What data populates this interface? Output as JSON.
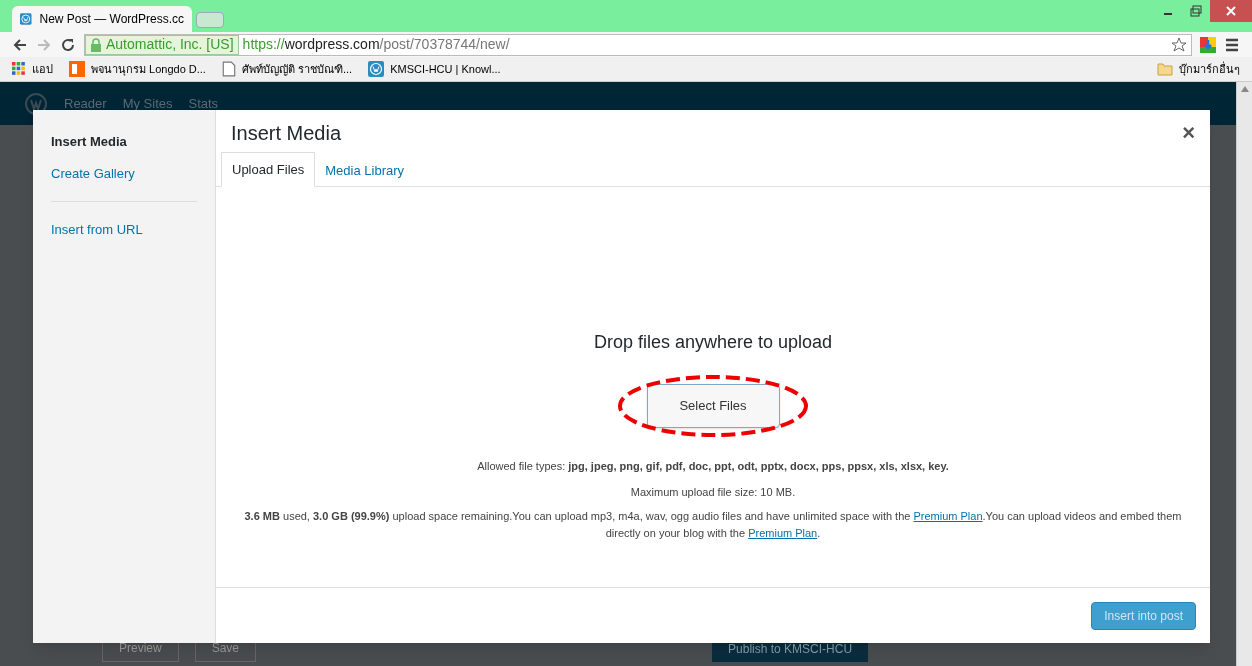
{
  "browser": {
    "tab_title": "New Post — WordPress.cc",
    "security_label": "Automattic, Inc. [US]",
    "url_scheme": "https://",
    "url_host": "wordpress.com",
    "url_path": "/post/70378744/new/",
    "bookmarks": [
      {
        "kind": "apps",
        "label": "แอป"
      },
      {
        "kind": "site",
        "label": "พจนานุกรม Longdo D..."
      },
      {
        "kind": "page",
        "label": "ศัพท์บัญญัติ ราชบัณฑิ..."
      },
      {
        "kind": "wp",
        "label": "KMSCI-HCU | Knowl..."
      }
    ],
    "other_bookmarks": "บุ๊กมาร์กอื่นๆ"
  },
  "wp_nav": [
    "Reader",
    "My Sites",
    "Stats"
  ],
  "background_buttons": {
    "preview": "Preview",
    "save": "Save",
    "publish": "Publish to KMSCI-HCU"
  },
  "modal": {
    "title": "Insert Media",
    "close": "×",
    "sidebar": [
      {
        "label": "Insert Media",
        "selected": true
      },
      {
        "label": "Create Gallery",
        "selected": false
      },
      {
        "label": "Insert from URL",
        "selected": false
      }
    ],
    "tabs": [
      {
        "label": "Upload Files",
        "selected": true
      },
      {
        "label": "Media Library",
        "selected": false
      }
    ],
    "drop_text": "Drop files anywhere to upload",
    "select_button": "Select Files",
    "allowed": "Allowed file types: **jpg, jpeg, png, gif, pdf, doc, ppt, odt, pptx, docx, pps, ppsx, xls, xlsx, key.**",
    "max_size": "Maximum upload file size: 10 MB.",
    "space_note": [
      {
        "kind": "text",
        "text": "**3.6 MB** used, **3.0 GB (99.9%)** upload space remaining.You can upload mp3, m4a, wav, ogg audio files and have unlimited space with the "
      },
      {
        "kind": "link",
        "text": "Premium Plan"
      },
      {
        "kind": "text",
        "text": ".You can upload videos and embed them directly on your blog with the "
      },
      {
        "kind": "link",
        "text": "Premium Plan"
      },
      {
        "kind": "text",
        "text": "."
      }
    ],
    "insert_button": "Insert into post",
    "insert_disabled": true
  }
}
